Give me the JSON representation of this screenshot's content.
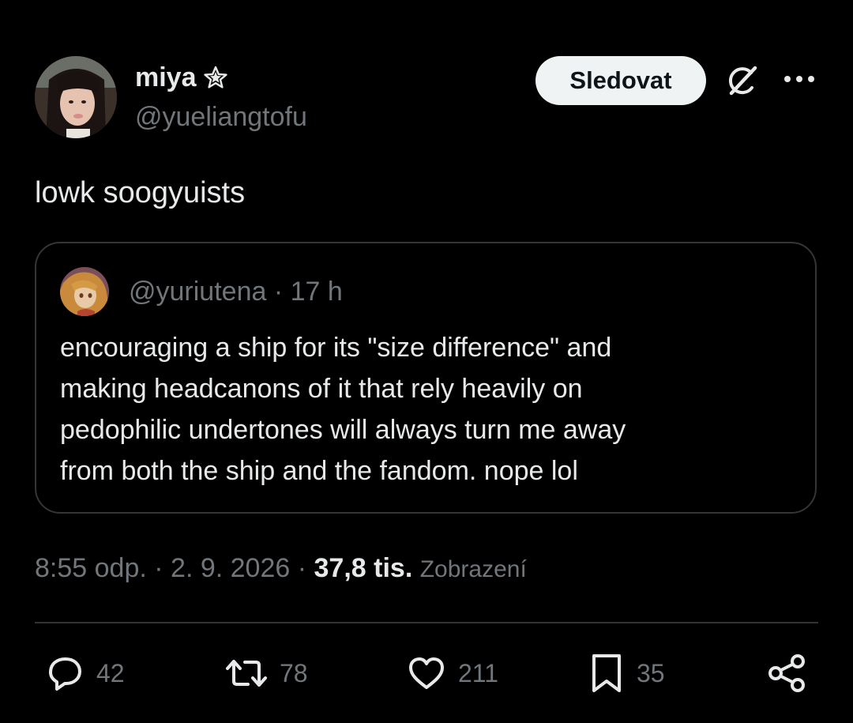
{
  "author": {
    "display_name": "miya",
    "handle": "@yueliangtofu"
  },
  "header": {
    "follow_label": "Sledovat"
  },
  "tweet": {
    "text": "lowk soogyuists"
  },
  "quote": {
    "handle": "@yuriutena",
    "separator": "·",
    "time": "17 h",
    "text_lines": [
      "encouraging a ship for its \"size difference\" and",
      "making headcanons of it that rely heavily on",
      "pedophilic undertones will always turn me away",
      "from both the ship and the fandom. nope lol"
    ]
  },
  "meta": {
    "time": "8:55 odp.",
    "date": "2. 9. 2026",
    "separator": "·",
    "views_count": "37,8 tis.",
    "views_label": "Zobrazení"
  },
  "actions": {
    "replies": "42",
    "reposts": "78",
    "likes": "211",
    "bookmarks": "35"
  },
  "icons": [
    "star-icon",
    "grok-icon",
    "more-icon",
    "reply-icon",
    "repost-icon",
    "like-icon",
    "bookmark-icon",
    "share-icon"
  ],
  "colors": {
    "background": "#000000",
    "text_primary": "#e7e9ea",
    "text_secondary": "#71767b",
    "border": "#333639",
    "follow_bg": "#eff3f4"
  }
}
